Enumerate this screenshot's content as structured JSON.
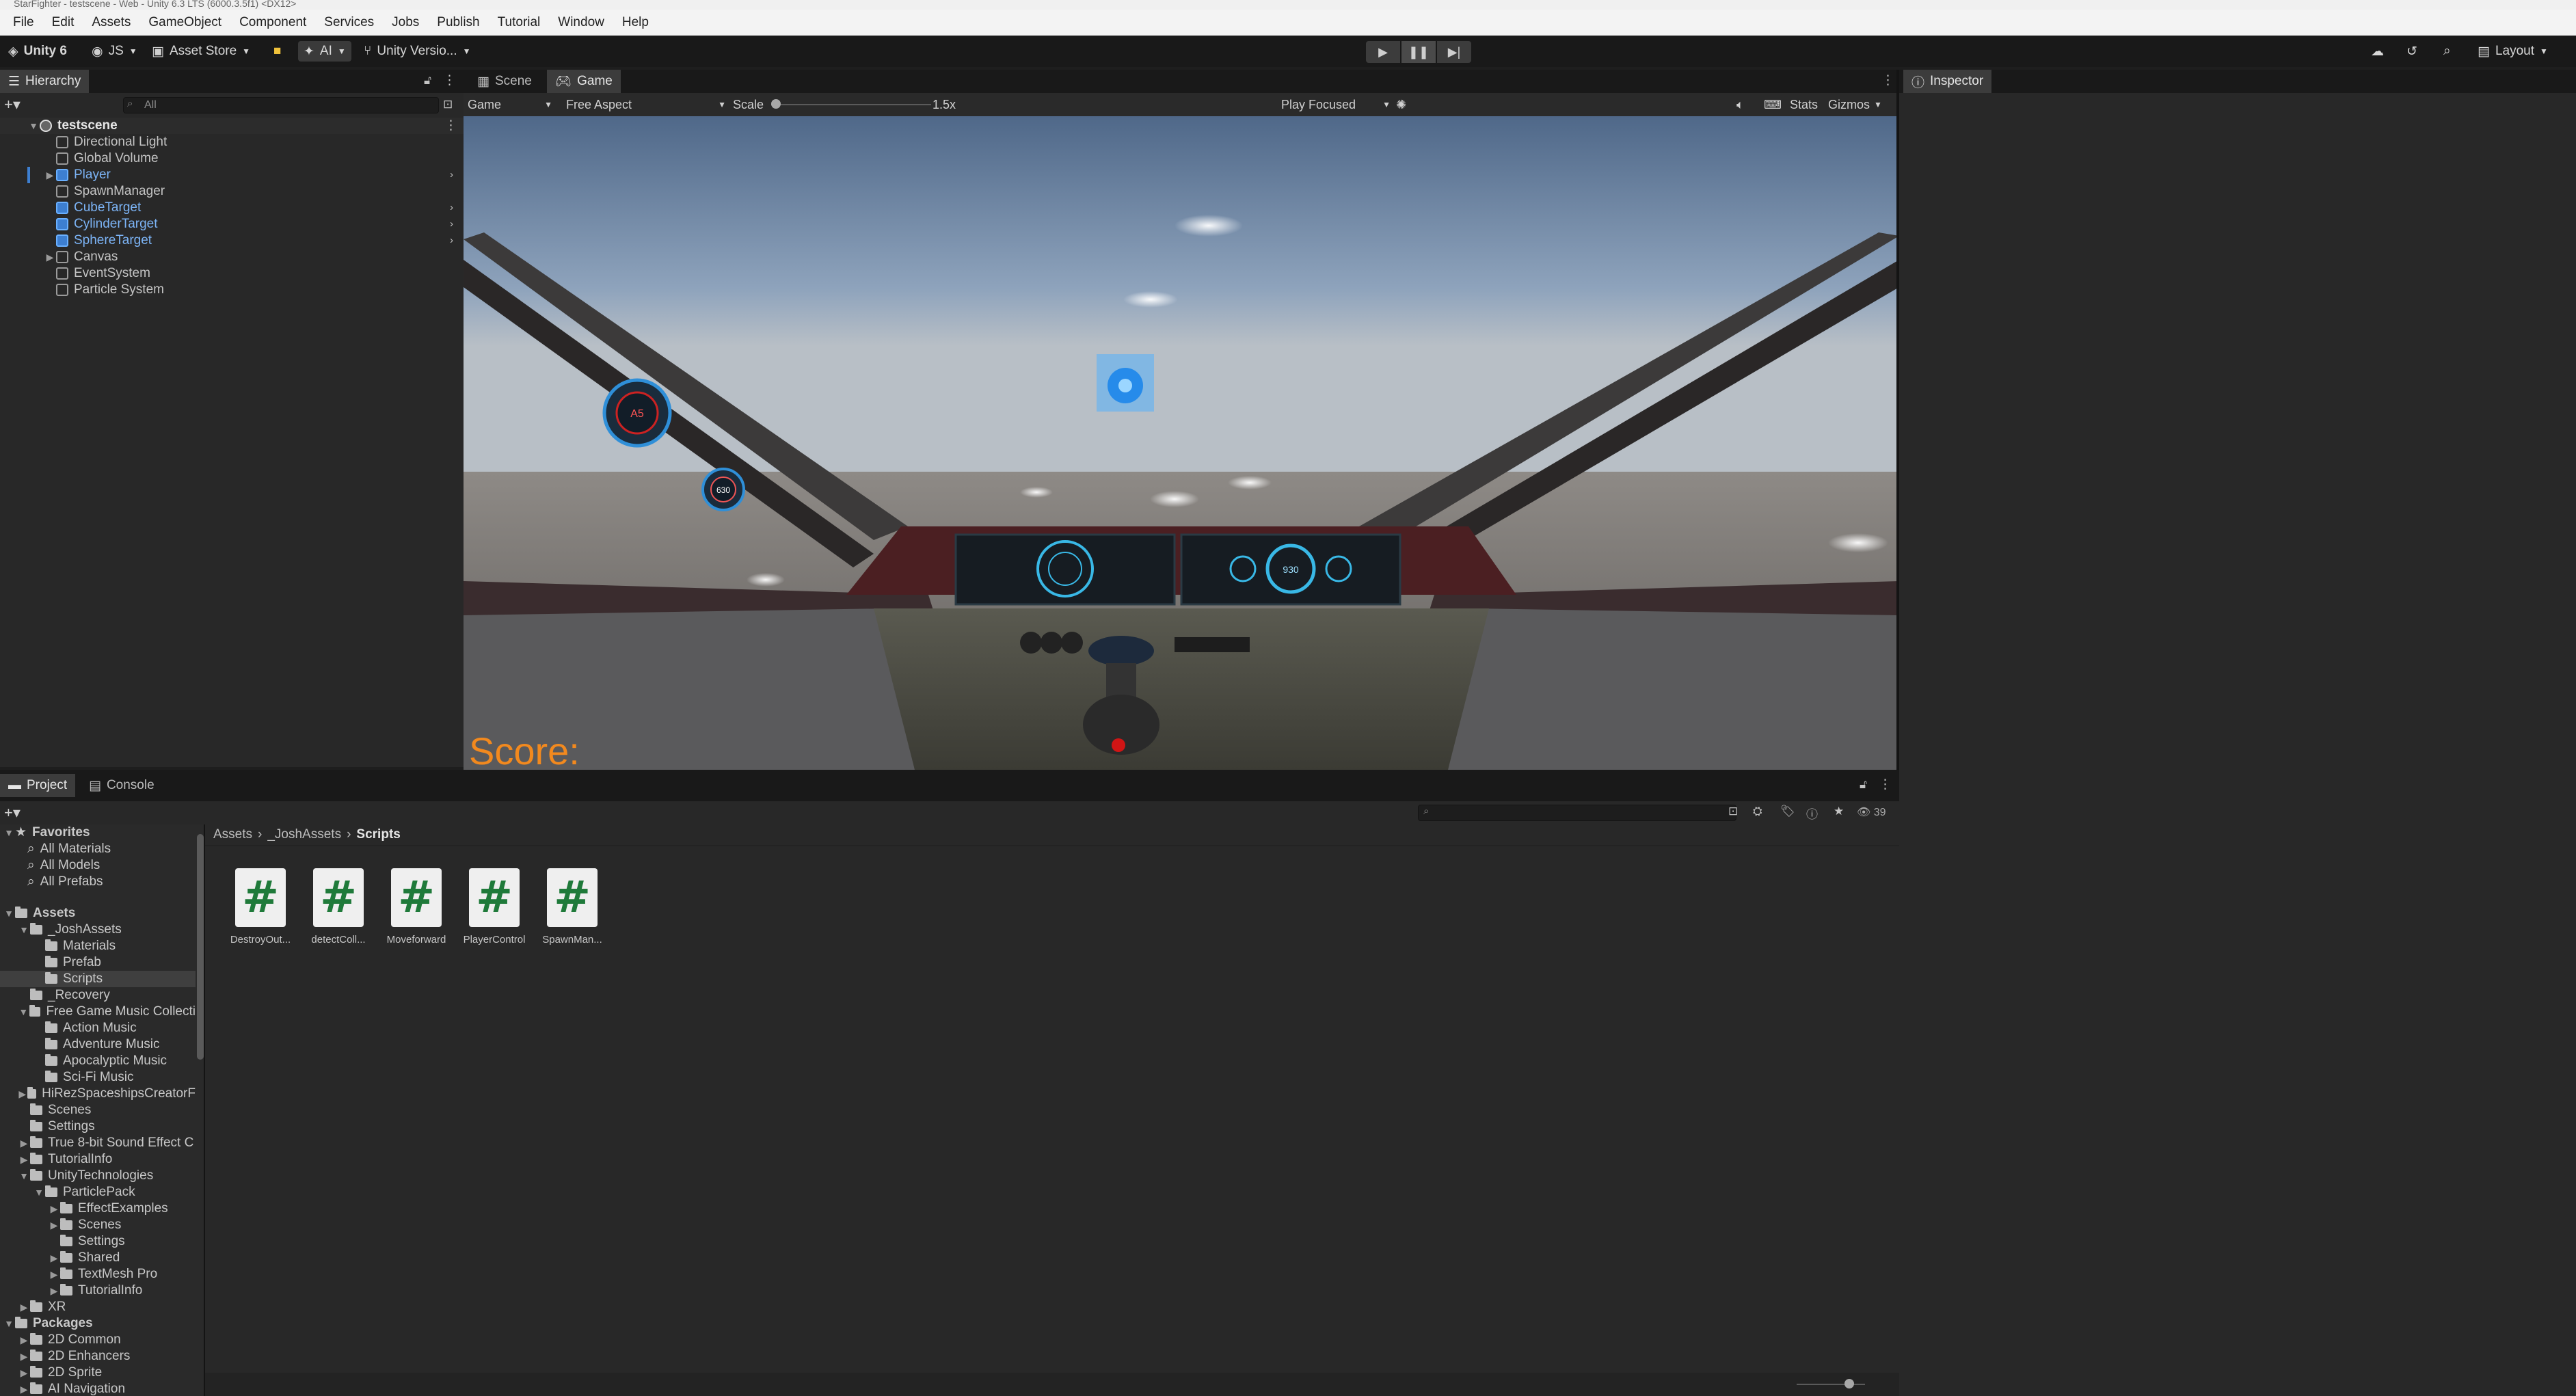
{
  "window": {
    "title": "StarFighter - testscene - Web - Unity 6.3 LTS (6000.3.5f1) <DX12>"
  },
  "menu": [
    "File",
    "Edit",
    "Assets",
    "GameObject",
    "Component",
    "Services",
    "Jobs",
    "Publish",
    "Tutorial",
    "Window",
    "Help"
  ],
  "toolbar": {
    "unity_label": "Unity 6",
    "account_label": "JS",
    "asset_store_label": "Asset Store",
    "ai_label": "AI",
    "version_control_label": "Unity Versio...",
    "layout_label": "Layout"
  },
  "hierarchy": {
    "tab_label": "Hierarchy",
    "search_placeholder": "All",
    "scene_name": "testscene",
    "items": [
      {
        "label": "Directional Light",
        "prefab": false,
        "expandable": false
      },
      {
        "label": "Global Volume",
        "prefab": false,
        "expandable": false
      },
      {
        "label": "Player",
        "prefab": true,
        "expandable": true
      },
      {
        "label": "SpawnManager",
        "prefab": false,
        "expandable": false
      },
      {
        "label": "CubeTarget",
        "prefab": true,
        "expandable": false
      },
      {
        "label": "CylinderTarget",
        "prefab": true,
        "expandable": false
      },
      {
        "label": "SphereTarget",
        "prefab": true,
        "expandable": false
      },
      {
        "label": "Canvas",
        "prefab": false,
        "expandable": true
      },
      {
        "label": "EventSystem",
        "prefab": false,
        "expandable": false
      },
      {
        "label": "Particle System",
        "prefab": false,
        "expandable": false
      }
    ]
  },
  "gameview": {
    "tabs": [
      "Scene",
      "Game"
    ],
    "display_dropdown": "Game",
    "aspect_dropdown": "Free Aspect",
    "scale_label": "Scale",
    "scale_value": "1.5x",
    "play_mode_dropdown": "Play Focused",
    "stats_label": "Stats",
    "gizmos_label": "Gizmos",
    "score_text": "Score:",
    "hud_dial_1": "A5",
    "hud_dial_2": "630",
    "console_dial": "930"
  },
  "inspector": {
    "tab_label": "Inspector"
  },
  "project": {
    "tabs": [
      "Project",
      "Console"
    ],
    "hidden_count": "39",
    "breadcrumb": [
      "Assets",
      "_JoshAssets",
      "Scripts"
    ],
    "favorites": {
      "label": "Favorites",
      "items": [
        "All Materials",
        "All Models",
        "All Prefabs"
      ]
    },
    "tree": [
      {
        "label": "Assets",
        "depth": 0,
        "bold": true,
        "expanded": true
      },
      {
        "label": "_JoshAssets",
        "depth": 1,
        "expanded": true
      },
      {
        "label": "Materials",
        "depth": 2
      },
      {
        "label": "Prefab",
        "depth": 2
      },
      {
        "label": "Scripts",
        "depth": 2,
        "selected": true
      },
      {
        "label": "_Recovery",
        "depth": 1
      },
      {
        "label": "Free Game Music Collecti",
        "depth": 1,
        "expanded": true
      },
      {
        "label": "Action Music",
        "depth": 2
      },
      {
        "label": "Adventure Music",
        "depth": 2
      },
      {
        "label": "Apocalyptic Music",
        "depth": 2
      },
      {
        "label": "Sci-Fi Music",
        "depth": 2
      },
      {
        "label": "HiRezSpaceshipsCreatorF",
        "depth": 1,
        "collapsed": true
      },
      {
        "label": "Scenes",
        "depth": 1
      },
      {
        "label": "Settings",
        "depth": 1
      },
      {
        "label": "True 8-bit Sound Effect C",
        "depth": 1,
        "collapsed": true
      },
      {
        "label": "TutorialInfo",
        "depth": 1,
        "collapsed": true
      },
      {
        "label": "UnityTechnologies",
        "depth": 1,
        "expanded": true
      },
      {
        "label": "ParticlePack",
        "depth": 2,
        "expanded": true
      },
      {
        "label": "EffectExamples",
        "depth": 3,
        "collapsed": true
      },
      {
        "label": "Scenes",
        "depth": 3,
        "collapsed": true
      },
      {
        "label": "Settings",
        "depth": 3
      },
      {
        "label": "Shared",
        "depth": 3,
        "collapsed": true
      },
      {
        "label": "TextMesh Pro",
        "depth": 3,
        "collapsed": true
      },
      {
        "label": "TutorialInfo",
        "depth": 3,
        "collapsed": true
      },
      {
        "label": "XR",
        "depth": 1,
        "collapsed": true
      },
      {
        "label": "Packages",
        "depth": 0,
        "bold": true,
        "expanded": true
      },
      {
        "label": "2D Common",
        "depth": 1,
        "collapsed": true
      },
      {
        "label": "2D Enhancers",
        "depth": 1,
        "collapsed": true
      },
      {
        "label": "2D Sprite",
        "depth": 1,
        "collapsed": true
      },
      {
        "label": "AI Navigation",
        "depth": 1,
        "collapsed": true
      }
    ],
    "assets": [
      {
        "label": "DestroyOut..."
      },
      {
        "label": "detectColl..."
      },
      {
        "label": "Moveforward"
      },
      {
        "label": "PlayerControl"
      },
      {
        "label": "SpawnMan..."
      }
    ]
  },
  "colors": {
    "accent_blue": "#7cb4f6",
    "score_orange": "#f2891e",
    "script_green": "#1f7a3a"
  }
}
